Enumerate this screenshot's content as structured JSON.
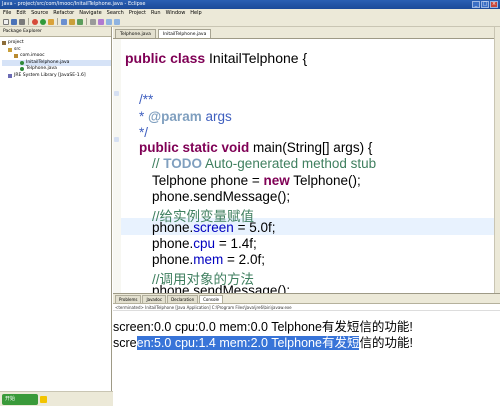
{
  "window": {
    "title": "Java - project/src/com/imooc/InitailTelphone.java - Eclipse"
  },
  "menu": [
    "File",
    "Edit",
    "Source",
    "Refactor",
    "Navigate",
    "Search",
    "Project",
    "Run",
    "Window",
    "Help"
  ],
  "package_explorer": {
    "title": "Package Explorer",
    "tree": [
      {
        "label": "project",
        "indent": 0
      },
      {
        "label": "src",
        "indent": 1
      },
      {
        "label": "com.imooc",
        "indent": 2
      },
      {
        "label": "InitailTelphone.java",
        "indent": 3
      },
      {
        "label": "Telphone.java",
        "indent": 3
      },
      {
        "label": "JRE System Library [JavaSE-1.6]",
        "indent": 1
      }
    ]
  },
  "editor": {
    "tabs": [
      "Telphone.java",
      "InitailTelphone.java"
    ],
    "active_tab": 1,
    "code": {
      "class_kw": "public class",
      "class_name": " InitailTelphone {",
      "jd_open": "/**",
      "jd_star": " * ",
      "jd_tag": "@param",
      "jd_param": " args",
      "jd_close": " */",
      "main_kw": "public static void",
      "main_sig": " main(String[] args) {",
      "todo_prefix": "// ",
      "todo_tag": "TODO",
      "todo_text": " Auto-generated method stub",
      "decl_a": "Telphone phone = ",
      "decl_new": "new",
      "decl_b": " Telphone();",
      "send1": "phone.sendMessage();",
      "comment1": "//给实例变量赋值",
      "s_obj": "phone.",
      "s_field": "screen",
      "s_val": " = 5.0f;",
      "c_obj": "phone.",
      "c_field": "cpu",
      "c_val": " = 1.4f;",
      "m_obj": "phone.",
      "m_field": "mem",
      "m_val": " = 2.0f;",
      "comment2": "//调用对象的方法",
      "send2": "phone.sendMessage();"
    }
  },
  "console": {
    "tabs": [
      "Problems",
      "Javadoc",
      "Declaration",
      "Console"
    ],
    "status": "<terminated> InitailTelphone [Java Application] C:\\Program Files\\Java\\jre6\\bin\\javaw.exe",
    "line1": "screen:0.0 cpu:0.0 mem:0.0 Telphone有发短信的功能!",
    "line2_plain": "scre",
    "line2_selected": "en:5.0 cpu:1.4 mem:2.0 Telphone有发短",
    "line2_rest": "信的功能!"
  },
  "statusbar": {
    "start_label": "开始"
  },
  "colors": {
    "keyword": "#7f0055",
    "comment": "#3f7f5f",
    "javadoc": "#3f5fbf",
    "field": "#0000c0",
    "selection": "#3874d8"
  }
}
